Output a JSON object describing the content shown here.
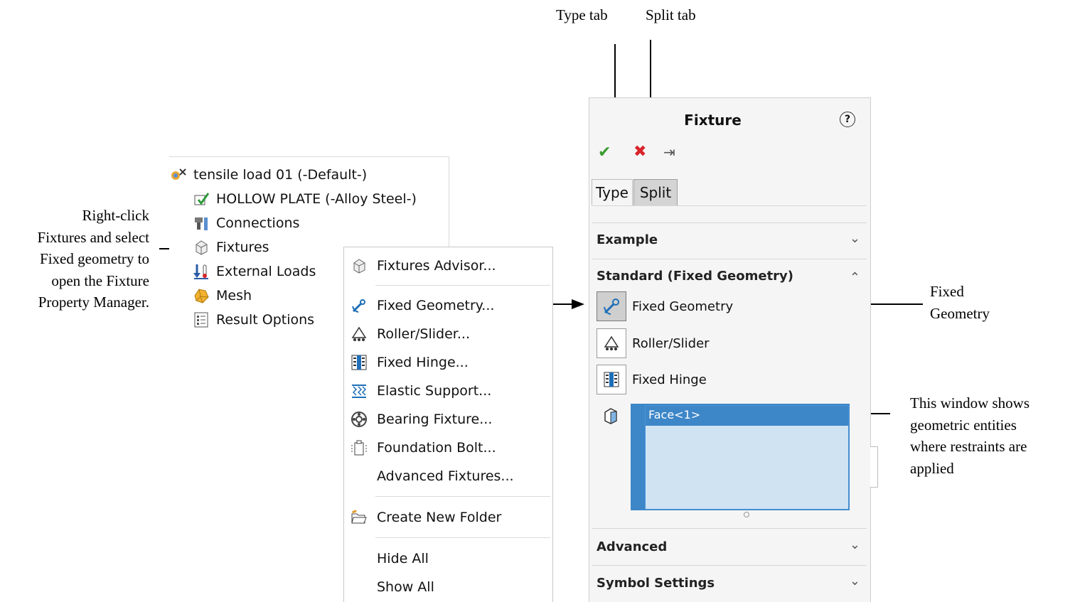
{
  "annotations": {
    "type_tab": "Type tab",
    "split_tab": "Split tab",
    "right_click_lines": [
      "Right-click",
      "Fixtures and select",
      "Fixed geometry to",
      "open the Fixture",
      "Property Manager."
    ],
    "fixed_geometry_lines": [
      "Fixed",
      "Geometry"
    ],
    "window_lines": [
      "This window shows",
      "geometric entities",
      "where restraints are",
      "applied"
    ]
  },
  "tree": {
    "items": [
      {
        "label": "tensile load 01 (-Default-)",
        "icon": "study-icon"
      },
      {
        "label": "HOLLOW PLATE (-Alloy Steel-)",
        "icon": "part-material-icon"
      },
      {
        "label": "Connections",
        "icon": "connections-icon"
      },
      {
        "label": "Fixtures",
        "icon": "fixtures-icon"
      },
      {
        "label": "External Loads",
        "icon": "external-loads-icon"
      },
      {
        "label": "Mesh",
        "icon": "mesh-icon"
      },
      {
        "label": "Result Options",
        "icon": "result-options-icon"
      }
    ]
  },
  "menu": {
    "items": [
      {
        "label": "Fixtures Advisor...",
        "icon": "fixtures-advisor-icon"
      },
      {
        "label": "Fixed Geometry...",
        "icon": "fixed-geometry-icon"
      },
      {
        "label": "Roller/Slider...",
        "icon": "roller-slider-icon"
      },
      {
        "label": "Fixed Hinge...",
        "icon": "fixed-hinge-icon"
      },
      {
        "label": "Elastic Support...",
        "icon": "elastic-support-icon"
      },
      {
        "label": "Bearing Fixture...",
        "icon": "bearing-fixture-icon"
      },
      {
        "label": "Foundation Bolt...",
        "icon": "foundation-bolt-icon"
      },
      {
        "label": "Advanced Fixtures...",
        "icon": ""
      },
      {
        "label": "Create New Folder",
        "icon": "folder-icon"
      },
      {
        "label": "Hide All",
        "icon": ""
      },
      {
        "label": "Show All",
        "icon": ""
      }
    ]
  },
  "pm": {
    "title": "Fixture",
    "help": "?",
    "tabs": [
      "Type",
      "Split"
    ],
    "sections": {
      "example": "Example",
      "standard": "Standard (Fixed Geometry)",
      "advanced": "Advanced",
      "symbol": "Symbol Settings"
    },
    "options": [
      "Fixed Geometry",
      "Roller/Slider",
      "Fixed Hinge"
    ],
    "selection": [
      "Face<1>"
    ]
  },
  "colors": {
    "ok": "#3a9b2e",
    "cancel": "#d9242a",
    "selection_blue": "#3d86c8"
  }
}
